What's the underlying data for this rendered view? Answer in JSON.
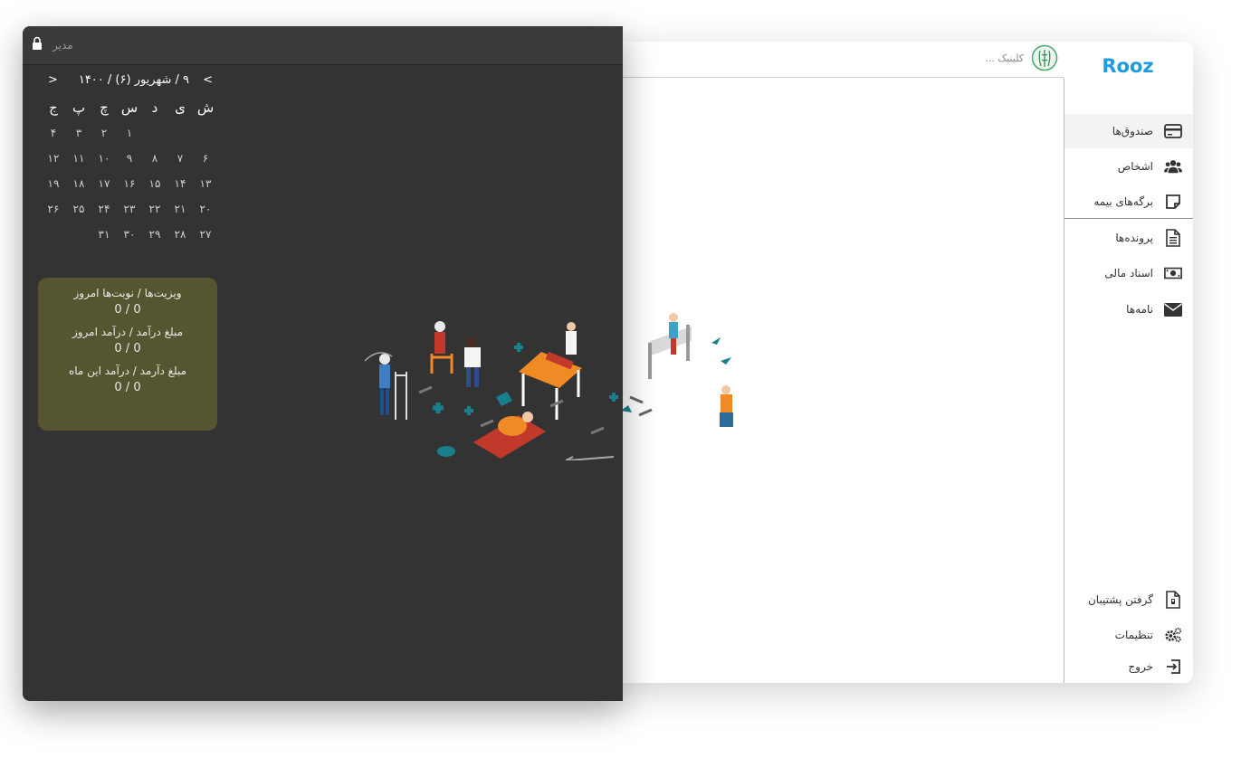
{
  "app": {
    "brand": "Rooz",
    "clinic_name": "کلینیک ...",
    "nav": [
      {
        "label": "صندوق‌ها",
        "icon": "card-icon",
        "active": true
      },
      {
        "label": "اشخاص",
        "icon": "users-icon",
        "active": false
      },
      {
        "label": "برگه‌های بیمه",
        "icon": "note-icon",
        "active": false
      },
      {
        "label": "پرونده‌ها",
        "icon": "file-icon",
        "active": false
      },
      {
        "label": "اسناد مالی",
        "icon": "money-icon",
        "active": false
      },
      {
        "label": "نامه‌ها",
        "icon": "envelope-icon",
        "active": false
      }
    ],
    "nav_bottom": [
      {
        "label": "گرفتن پشتیبان",
        "icon": "backup-icon"
      },
      {
        "label": "تنظیمات",
        "icon": "gears-icon"
      },
      {
        "label": "خروج",
        "icon": "logout-icon"
      }
    ]
  },
  "dashboard": {
    "user": "مدیر",
    "calendar": {
      "title": "۹ / شهریور (۶) / ۱۴۰۰",
      "prev": "<",
      "next": ">",
      "weekdays": [
        "ش",
        "ی",
        "د",
        "س",
        "چ",
        "پ",
        "ج"
      ],
      "weeks": [
        [
          "",
          "",
          "",
          "۱",
          "۲",
          "۳",
          "۴"
        ],
        [
          "۶",
          "۷",
          "۸",
          "۹",
          "۱۰",
          "۱۱",
          "۱۲"
        ],
        [
          "۱۳",
          "۱۴",
          "۱۵",
          "۱۶",
          "۱۷",
          "۱۸",
          "۱۹"
        ],
        [
          "۲۰",
          "۲۱",
          "۲۲",
          "۲۳",
          "۲۴",
          "۲۵",
          "۲۶"
        ],
        [
          "۲۷",
          "۲۸",
          "۲۹",
          "۳۰",
          "۳۱",
          "",
          ""
        ]
      ]
    },
    "stats": [
      {
        "label": "ویزیت‌ها / نوبت‌ها امروز",
        "value": "0 / 0"
      },
      {
        "label": "مبلغ درآمد / درآمد امروز",
        "value": "0 / 0"
      },
      {
        "label": "مبلغ دآرمد / درآمد این ماه",
        "value": "0 / 0"
      }
    ]
  }
}
